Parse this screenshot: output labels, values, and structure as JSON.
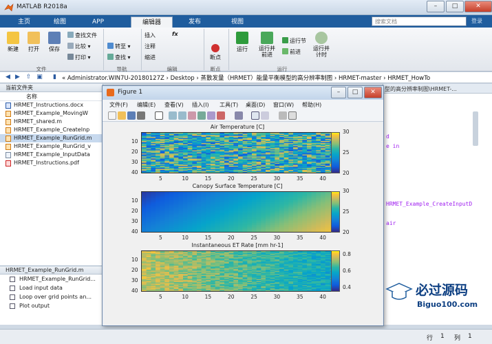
{
  "window": {
    "title": "MATLAB R2018a",
    "min": "–",
    "max": "□",
    "close": "✕"
  },
  "tabs": [
    "主页",
    "绘图",
    "APP",
    "编辑器",
    "发布",
    "视图"
  ],
  "search": {
    "placeholder": "搜索文档",
    "button": "登录"
  },
  "ribbon": {
    "new": "新建",
    "open": "打开",
    "save": "保存",
    "find_files": "查找文件",
    "compare": "比较",
    "print": "打印",
    "insert": "插入",
    "comment": "注释",
    "indent": "缩进",
    "fx": "fx",
    "goto": "转至",
    "find": "查找",
    "breakpoints": "断点",
    "run": "运行",
    "run_advance": "运行并\n前进",
    "run_section": "运行节",
    "advance": "前进",
    "run_time": "运行并\n计时",
    "groups": [
      "文件",
      "导航",
      "编辑",
      "断点",
      "运行"
    ]
  },
  "address": {
    "path": "« Administrator.WIN7U-20180127Z  ›  Desktop  ›  蒸散发量（HRMET）能量平衡模型的高分辨率制图  ›  HRMET-master  ›  HRMET_HowTo"
  },
  "current_folder": {
    "title": "当前文件夹",
    "name_col": "名称",
    "files": [
      "HRMET_Instructions.docx",
      "HRMET_Example_MovingW",
      "HRMET_shared.m",
      "HRMET_Example_CreateInp",
      "HRMET_Example_RunGrid.m",
      "HRMET_Example_RunGrid_v",
      "HRMET_Example_InputData",
      "HRMET_Instructions.pdf"
    ]
  },
  "details": {
    "title": "HRMET_Example_RunGrid.m",
    "items": [
      "HRMET_Example_RunGrid...",
      "Load input data",
      "Loop over grid points an...",
      "Plot output"
    ]
  },
  "editor": {
    "lines": [
      "d",
      "e in",
      "HRMET_Example_CreateInputD",
      "air"
    ],
    "fragment": "型的高分辨率制图\\HRMET-..."
  },
  "figure": {
    "title": "Figure 1",
    "menu": [
      "文件(F)",
      "编辑(E)",
      "查看(V)",
      "插入(I)",
      "工具(T)",
      "桌面(D)",
      "窗口(W)",
      "帮助(H)"
    ]
  },
  "chart_data": [
    {
      "type": "heatmap",
      "title": "Air Temperature [C]",
      "x_ticks": [
        5,
        10,
        15,
        20,
        25,
        30,
        35,
        40
      ],
      "y_ticks": [
        10,
        20,
        30,
        40
      ],
      "colorbar": {
        "min": 20,
        "max": 30,
        "ticks": [
          20,
          25,
          30
        ]
      },
      "colormap": "parula",
      "xlim": [
        1,
        42
      ],
      "ylim": [
        1,
        40
      ]
    },
    {
      "type": "heatmap",
      "title": "Canopy Surface Temperature [C]",
      "x_ticks": [
        5,
        10,
        15,
        20,
        25,
        30,
        35,
        40
      ],
      "y_ticks": [
        10,
        20,
        30,
        40
      ],
      "colorbar": {
        "min": 20,
        "max": 30,
        "ticks": [
          20,
          25,
          30
        ]
      },
      "colormap": "parula",
      "xlim": [
        1,
        42
      ],
      "ylim": [
        1,
        40
      ]
    },
    {
      "type": "heatmap",
      "title": "Instantaneous ET Rate [mm hr-1]",
      "x_ticks": [
        5,
        10,
        15,
        20,
        25,
        30,
        35,
        40
      ],
      "y_ticks": [
        10,
        20,
        30,
        40
      ],
      "colorbar": {
        "min": 0.35,
        "max": 0.85,
        "ticks": [
          0.4,
          0.6,
          0.8
        ]
      },
      "colormap": "parula",
      "xlim": [
        1,
        42
      ],
      "ylim": [
        1,
        40
      ]
    }
  ],
  "statusbar": {
    "row_label": "行",
    "row": "1",
    "col_label": "列",
    "col": "1"
  },
  "watermark": {
    "brand": "必过源码",
    "site": "Biguo100.com"
  }
}
